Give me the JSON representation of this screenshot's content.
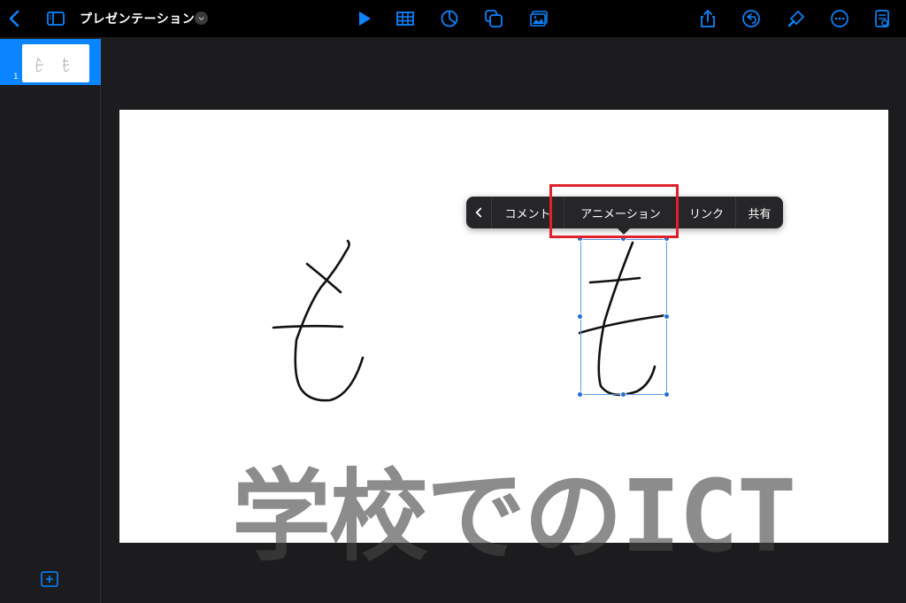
{
  "toolbar": {
    "title": "プレゼンテーション",
    "icons": [
      "back-chevron-icon",
      "sidebar-toggle-icon",
      "title-menu-chevron-icon",
      "play-icon",
      "table-icon",
      "chart-icon",
      "shapes-icon",
      "media-icon",
      "share-icon",
      "undo-icon",
      "format-brush-icon",
      "more-icon",
      "presenter-notes-icon"
    ],
    "accent_color": "#0a84ff"
  },
  "sidebar": {
    "slides": [
      {
        "number": "1",
        "thumbnail_text": "も も",
        "selected": true
      }
    ],
    "add_slide_icon": "plus-square-icon"
  },
  "context_menu": {
    "back_icon": "chevron-left-icon",
    "items": [
      {
        "label": "コメント"
      },
      {
        "label": "アニメーション",
        "highlighted": true
      },
      {
        "label": "リンク"
      },
      {
        "label": "共有"
      }
    ],
    "highlight_color": "#e0202a"
  },
  "slide": {
    "drawings": [
      "handwritten-mo-left",
      "handwritten-mo-right-selected"
    ]
  },
  "watermark": {
    "text": "学校でのICT"
  }
}
